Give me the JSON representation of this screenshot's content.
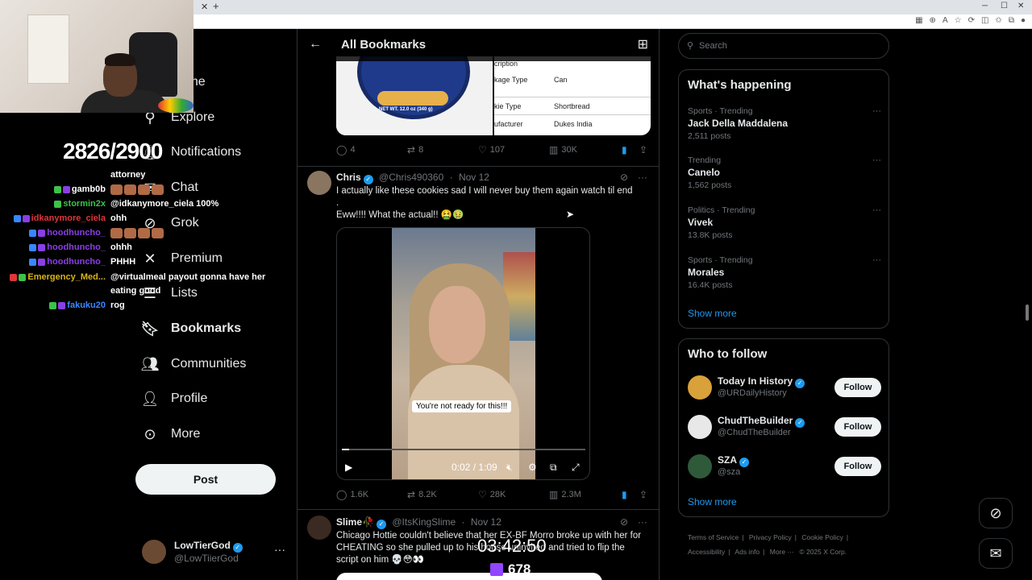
{
  "stream": {
    "counter": "2826/2900",
    "timer": "03:42:50",
    "viewers": "678",
    "chat": [
      {
        "user": "",
        "msg": "attorney",
        "color": "#ffffff"
      },
      {
        "user": "gamb0b",
        "msg": "",
        "color": "#ffffff"
      },
      {
        "user": "stormin2x",
        "msg": "@idkanymore_ciela 100%",
        "color": "#3cc24a"
      },
      {
        "user": "idkanymore_ciela",
        "msg": "ohh",
        "color": "#e0353b"
      },
      {
        "user": "hoodhuncho_",
        "msg": "",
        "color": "#8a3ee6"
      },
      {
        "user": "hoodhuncho_",
        "msg": "ohhh",
        "color": "#8a3ee6"
      },
      {
        "user": "hoodhuncho_",
        "msg": "PHHH",
        "color": "#8a3ee6"
      },
      {
        "user": "Emergency_Med...",
        "msg": "@virtualmeal payout gonna have her",
        "color": "#d9b418"
      },
      {
        "user": "",
        "msg": "eating good",
        "color": "#ffffff"
      },
      {
        "user": "fakuku20",
        "msg": "rog",
        "color": "#3a86ff"
      }
    ]
  },
  "nav": {
    "items": [
      {
        "label": "Home",
        "icon": "home-icon"
      },
      {
        "label": "Explore",
        "icon": "search-icon"
      },
      {
        "label": "Notifications",
        "icon": "bell-icon"
      },
      {
        "label": "Chat",
        "icon": "mail-icon"
      },
      {
        "label": "Grok",
        "icon": "grok-icon"
      },
      {
        "label": "Premium",
        "icon": "x-logo-icon"
      },
      {
        "label": "Lists",
        "icon": "list-icon"
      },
      {
        "label": "Bookmarks",
        "icon": "bookmark-icon"
      },
      {
        "label": "Communities",
        "icon": "communities-icon"
      },
      {
        "label": "Profile",
        "icon": "person-icon"
      },
      {
        "label": "More",
        "icon": "more-circle-icon"
      }
    ],
    "post_label": "Post",
    "account": {
      "name": "LowTierGod",
      "handle": "@LowTiierGod"
    }
  },
  "header": {
    "title": "All Bookmarks"
  },
  "card": {
    "netwt": "NET WT. 12.0 oz (340 g)",
    "rows": [
      {
        "k": "cription",
        "v": ""
      },
      {
        "k": "kage Type",
        "v": "Can"
      },
      {
        "k": "kie Type",
        "v": "Shortbread"
      },
      {
        "k": "ufacturer",
        "v": "Dukes India"
      }
    ]
  },
  "tweet0_stats": {
    "replies": "4",
    "reposts": "8",
    "likes": "107",
    "views": "30K"
  },
  "tweet1": {
    "name": "Chris",
    "handle": "@Chris490360",
    "date": "Nov 12",
    "text1": "I actually like these cookies sad I will never buy them again watch til end",
    "text2": ".",
    "text3": "Eww!!!! What the actual!! 🤮🤢",
    "video_caption": "You're not ready for this!!!",
    "video_time": "0:02 / 1:09",
    "progress": 0.03,
    "stats": {
      "replies": "1.6K",
      "reposts": "8.2K",
      "likes": "28K",
      "views": "2.3M"
    }
  },
  "tweet2": {
    "name": "Slime🥀",
    "handle": "@ItsKingSlime",
    "date": "Nov 12",
    "text": "Chicago Hottie couldn't believe that her EX-BF Morro broke up with her for CHEATING so she pulled up to his house uninvited and tried to flip the script on him 💀😳👀"
  },
  "right": {
    "search_placeholder": "Search",
    "happening_title": "What's happening",
    "trends": [
      {
        "cat": "Sports · Trending",
        "name": "Jack Della Maddalena",
        "count": "2,511 posts"
      },
      {
        "cat": "Trending",
        "name": "Canelo",
        "count": "1,562 posts"
      },
      {
        "cat": "Politics · Trending",
        "name": "Vivek",
        "count": "13.8K posts"
      },
      {
        "cat": "Sports · Trending",
        "name": "Morales",
        "count": "16.4K posts"
      }
    ],
    "show_more": "Show more",
    "follow_title": "Who to follow",
    "follows": [
      {
        "name": "Today In History",
        "handle": "@URDailyHistory",
        "btn": "Follow"
      },
      {
        "name": "ChudTheBuilder",
        "handle": "@ChudTheBuilder",
        "btn": "Follow"
      },
      {
        "name": "SZA",
        "handle": "@sza",
        "btn": "Follow"
      }
    ],
    "footer": [
      "Terms of Service",
      "|",
      "Privacy Policy",
      "|",
      "Cookie Policy",
      "|",
      "Accessibility",
      "|",
      "Ads info",
      "|",
      "More ···",
      "© 2025 X Corp."
    ]
  }
}
